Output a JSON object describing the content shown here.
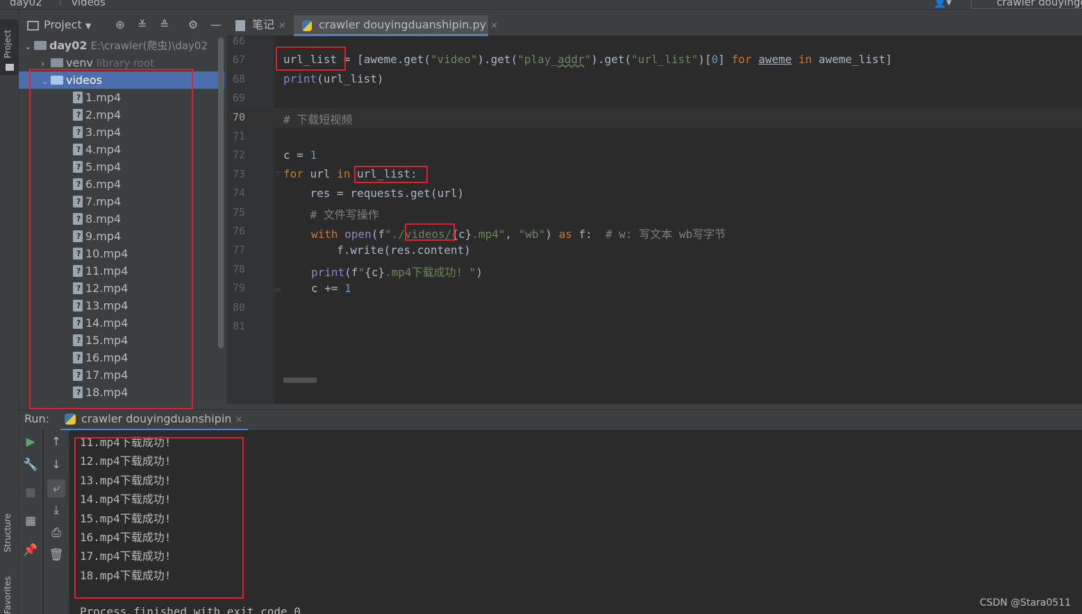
{
  "breadcrumb": {
    "root": "day02",
    "folder": "videos",
    "run_config": "crawler douyingd"
  },
  "toolwindows": {
    "project": "Project",
    "structure": "Structure",
    "favorites": "Favorites"
  },
  "project_panel": {
    "title": "Project",
    "root": {
      "name": "day02",
      "path": "E:\\crawler(爬虫)\\day02"
    },
    "venv": {
      "name": "venv",
      "note": "library root"
    },
    "videos_folder": "videos",
    "files": [
      "1.mp4",
      "2.mp4",
      "3.mp4",
      "4.mp4",
      "5.mp4",
      "6.mp4",
      "7.mp4",
      "8.mp4",
      "9.mp4",
      "10.mp4",
      "11.mp4",
      "12.mp4",
      "13.mp4",
      "14.mp4",
      "15.mp4",
      "16.mp4",
      "17.mp4",
      "18.mp4"
    ]
  },
  "editor": {
    "tabs": [
      {
        "label": "笔记",
        "active": false
      },
      {
        "label": "crawler douyingduanshipin.py",
        "active": true
      }
    ],
    "line_numbers": [
      "66",
      "67",
      "68",
      "69",
      "70",
      "71",
      "72",
      "73",
      "74",
      "75",
      "76",
      "77",
      "78",
      "79",
      "80",
      "81"
    ],
    "current_line": "70",
    "code": {
      "l67_var": "url_list",
      "l67_a": " = [aweme.get(",
      "l67_s1": "\"video\"",
      "l67_b": ").get(",
      "l67_s2a": "\"play_",
      "l67_s2b": "addr",
      "l67_s2c": "\"",
      "l67_c": ").get(",
      "l67_s3": "\"url_list\"",
      "l67_d": ")[",
      "l67_n": "0",
      "l67_e": "] ",
      "l67_for": "for",
      "l67_aweme": "aweme",
      "l67_in": "in",
      "l67_f": " aweme_list]",
      "l68_fn": "print",
      "l68_rest": "(url_list)",
      "l70": "# 下载短视频",
      "l72_a": "c = ",
      "l72_n": "1",
      "l73_for": "for",
      "l73_a": " url ",
      "l73_in": "in",
      "l73_b": " url_list:",
      "l74": "    res = requests.get(url)",
      "l75": "    # 文件写操作",
      "l76_with": "with",
      "l76_open": "open",
      "l76_p": "(f",
      "l76_s1": "\"./",
      "l76_s2": "videos",
      "l76_s3": "/",
      "l76_c1": "{c}",
      "l76_s4": ".mp4\"",
      "l76_comma": ", ",
      "l76_s5": "\"wb\"",
      "l76_rp": ") ",
      "l76_as": "as",
      "l76_f": " f:  ",
      "l76_cm": "# w: 写文本 wb写字节",
      "l77": "        f.write(res.content)",
      "l78_fn": "print",
      "l78_p": "(f",
      "l78_s1": "\"",
      "l78_c": "{c}",
      "l78_s2": ".mp4下载成功! \"",
      "l78_rp": ")",
      "l79_a": "c += ",
      "l79_n": "1"
    }
  },
  "run": {
    "label": "Run:",
    "tab": "crawler douyingduanshipin",
    "output": [
      "11.mp4下载成功!",
      "12.mp4下载成功!",
      "13.mp4下载成功!",
      "14.mp4下载成功!",
      "15.mp4下载成功!",
      "16.mp4下载成功!",
      "17.mp4下载成功!",
      "18.mp4下载成功!"
    ],
    "finished": "Process finished with exit code 0"
  },
  "watermark": "CSDN @Stara0511",
  "colors": {
    "highlight": "#e0202a",
    "selection": "#4b6eaf",
    "keyword": "#cc7832",
    "string": "#6a8759",
    "number": "#6897bb"
  }
}
